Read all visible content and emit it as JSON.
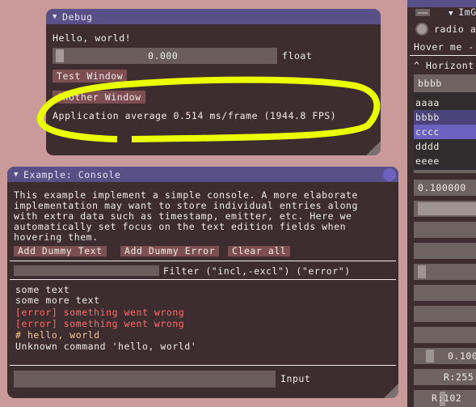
{
  "debug_window": {
    "title": "Debug",
    "hello_text": "Hello, world!",
    "slider_value": "0.000",
    "slider_fraction": 0.0,
    "slider_label": "float",
    "buttons": [
      "Test Window",
      "Another Window"
    ],
    "fps_text": "Application average 0.514 ms/frame (1944.8 FPS)"
  },
  "console_window": {
    "title": "Example: Console",
    "description": [
      "This example implement a simple console. A more elaborate",
      "implementation may want to store individual entries along",
      "with extra data such as timestamp, emitter, etc. Here we",
      "automatically set focus on the text edition fields when",
      "hovering them."
    ],
    "buttons": [
      "Add Dummy Text",
      "Add Dummy Error",
      "Clear all"
    ],
    "filter_value": "",
    "filter_label": "Filter (\"incl,-excl\") (\"error\")",
    "log": [
      {
        "text": "some text",
        "type": "normal"
      },
      {
        "text": "some more text",
        "type": "normal"
      },
      {
        "text": "[error] something went wrong",
        "type": "error"
      },
      {
        "text": "[error] something went wrong",
        "type": "error"
      },
      {
        "text": "# hello, world",
        "type": "command"
      },
      {
        "text": "Unknown command 'hello, world'",
        "type": "normal"
      }
    ],
    "input_value": "",
    "input_label": "Input"
  },
  "test_window": {
    "title": "ImGui Te",
    "radio_label": "radio a",
    "hover_text": "Hover me -",
    "horizontal_header": "^ Horizont",
    "combo_value": "bbbb",
    "list_items": [
      "aaaa",
      "bbbb",
      "cccc",
      "dddd",
      "eeee"
    ],
    "list_hovered": "bbbb",
    "list_selected": "cccc",
    "float_input": "0.100000",
    "drag_value": "0.100",
    "color_r_255": "R:255",
    "color_r_102": "R:102"
  },
  "annotation": {
    "color": "#eaff00",
    "shape": "ellipse-around-fps-text"
  },
  "colors": {
    "background": "#c99a99",
    "window_bg": "#3d2d2f",
    "titlebar": "#5a5088",
    "button": "#7e4f52",
    "frame": "#6a5d5c",
    "error": "#ff6b6b",
    "command": "#ffc78a",
    "list_hover": "#4a447a",
    "list_selected": "#6b63bf"
  }
}
